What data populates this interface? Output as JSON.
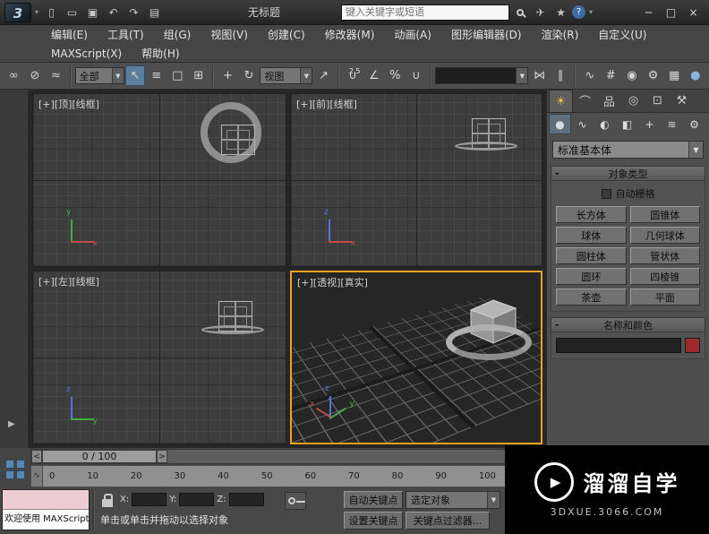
{
  "colors": {
    "active_viewport": "#f0a21a",
    "object_color": "#9e2b2b"
  },
  "titlebar": {
    "title": "无标题",
    "search_placeholder": "键入关键字或短语",
    "logo": "3",
    "icons": {
      "new": "▯",
      "open": "▭",
      "save": "▣",
      "undo": "↶",
      "redo": "↷",
      "workspace": "▤",
      "community": "✈",
      "favorites": "★",
      "help": "?",
      "menu_caret": "▾",
      "minimize": "─",
      "maximize": "□",
      "close": "×"
    }
  },
  "menus": {
    "row1": [
      "编辑(E)",
      "工具(T)",
      "组(G)",
      "视图(V)",
      "创建(C)",
      "修改器(M)",
      "动画(A)",
      "图形编辑器(D)",
      "渲染(R)",
      "自定义(U)"
    ],
    "row2": [
      "MAXScript(X)",
      "帮助(H)"
    ]
  },
  "toolbar": {
    "selection_filter": "全部",
    "reference_coordinate": "视图",
    "snap_mode": "2.5",
    "icons": {
      "select_link": "∞",
      "unlink": "⊘",
      "bind_space_warp": "≈",
      "select": "↖",
      "select_by_name": "≡",
      "region": "□",
      "window_crossing": "⊞",
      "move": "+",
      "rotate": "↻",
      "scale": "↗",
      "snap": "∪",
      "angle_snap": "∠",
      "percent_snap": "%",
      "spinner_snap": "∪",
      "mirror": "⋈",
      "align": "∥",
      "curve_editor": "∿",
      "schematic": "#",
      "material": "◉",
      "render_setup": "⚙",
      "rendered_frame": "▦",
      "render": "●",
      "caret": "▼"
    }
  },
  "viewports": {
    "top": {
      "label": "[+][顶][线框]",
      "axis": {
        "up": "y",
        "right": "x"
      }
    },
    "front": {
      "label": "[+][前][线框]",
      "axis": {
        "up": "z",
        "right": "x"
      }
    },
    "left": {
      "label": "[+][左][线框]",
      "axis": {
        "up": "z",
        "right": "y"
      }
    },
    "perspective": {
      "label": "[+][透视][真实]",
      "axis": {
        "up": "z",
        "left": "x",
        "right": "y"
      }
    }
  },
  "command_panel": {
    "tabs": [
      {
        "name": "create",
        "glyph": "☀"
      },
      {
        "name": "modify",
        "glyph": "⌒"
      },
      {
        "name": "hierarchy",
        "glyph": "品"
      },
      {
        "name": "motion",
        "glyph": "◎"
      },
      {
        "name": "display",
        "glyph": "⊡"
      },
      {
        "name": "utilities",
        "glyph": "⚒"
      }
    ],
    "subtabs": [
      {
        "name": "geometry",
        "glyph": "●"
      },
      {
        "name": "shapes",
        "glyph": "∿"
      },
      {
        "name": "lights",
        "glyph": "◐"
      },
      {
        "name": "cameras",
        "glyph": "◧"
      },
      {
        "name": "helpers",
        "glyph": "+"
      },
      {
        "name": "space-warps",
        "glyph": "≋"
      },
      {
        "name": "systems",
        "glyph": "⚙"
      }
    ],
    "category_dropdown": "标准基本体",
    "rollouts": {
      "object_type": "对象类型",
      "name_color": "名称和颜色"
    },
    "minus": "-",
    "autogrid_label": "自动栅格",
    "object_buttons": [
      "长方体",
      "圆锥体",
      "球体",
      "几何球体",
      "圆柱体",
      "管状体",
      "圆环",
      "四棱锥",
      "茶壶",
      "平面"
    ]
  },
  "timeline": {
    "thumb": "0 / 100",
    "prev": "<",
    "next": ">",
    "ticks": [
      "0",
      "10",
      "20",
      "30",
      "40",
      "50",
      "60",
      "70",
      "80",
      "90",
      "100"
    ]
  },
  "statusbar": {
    "listener_text": "欢迎使用 MAXScript",
    "prompt": "单击或单击并拖动以选择对象",
    "x_label": "X:",
    "y_label": "Y:",
    "z_label": "Z:",
    "auto_key": "自动关键点",
    "set_key": "设置关键点",
    "selection_set": "选定对象",
    "key_filters": "关键点过滤器..."
  },
  "watermark": {
    "brand": "溜溜自学",
    "url": "3DXUE.3066.COM",
    "play": "▶"
  }
}
